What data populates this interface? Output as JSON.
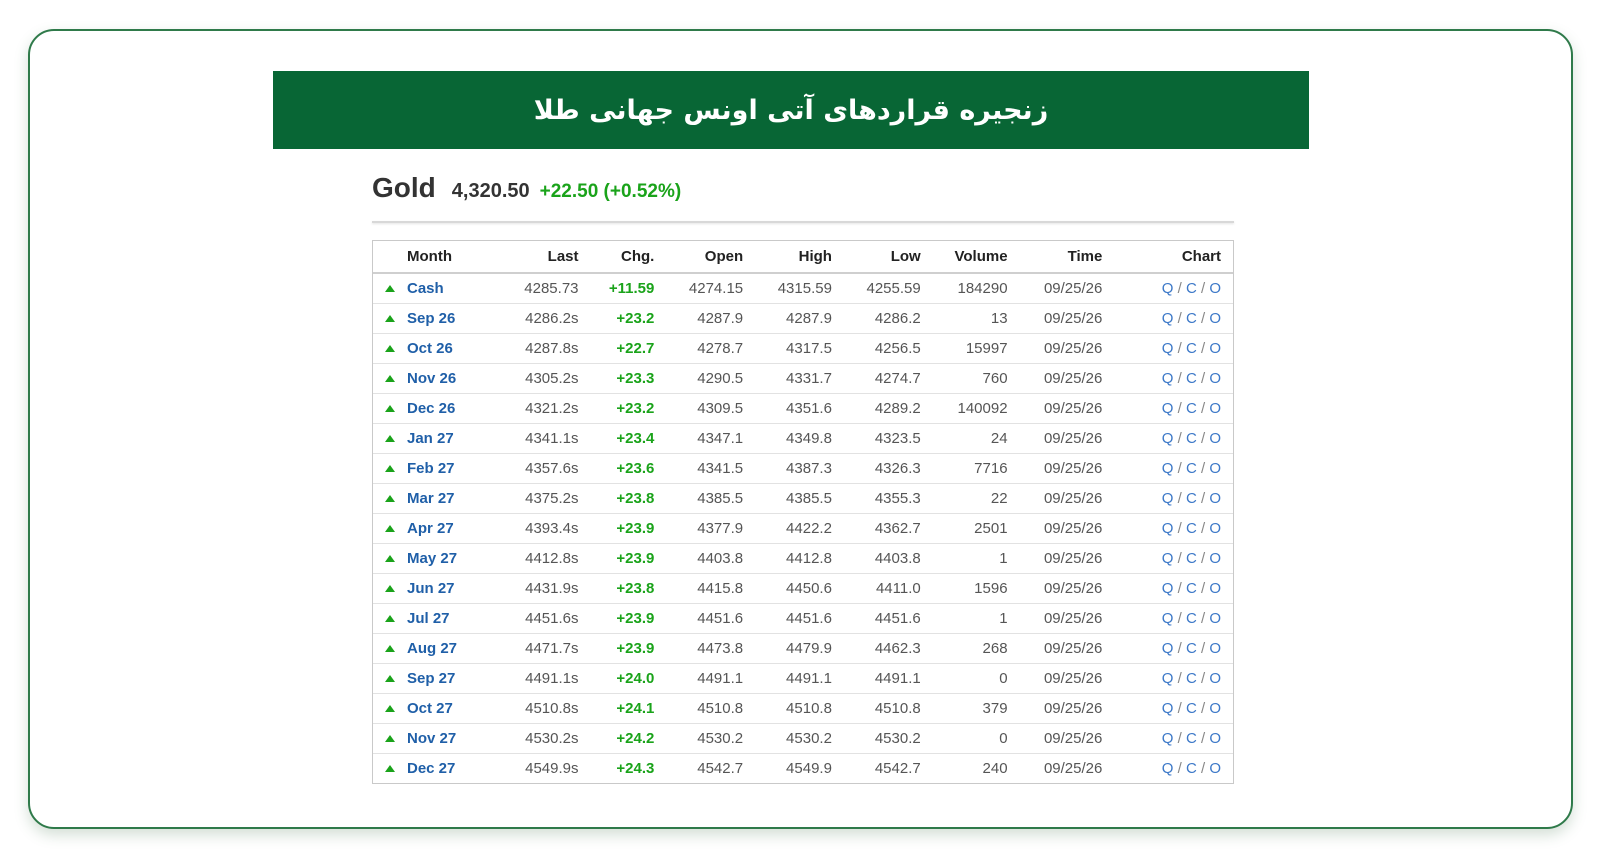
{
  "banner": {
    "title": "زنجیره قراردهای آتی اونس جهانی طلا"
  },
  "quote": {
    "name": "Gold",
    "price": "4,320.50",
    "change": "+22.50 (+0.52%)"
  },
  "table": {
    "columns": [
      "Month",
      "Last",
      "Chg.",
      "Open",
      "High",
      "Low",
      "Volume",
      "Time",
      "Chart"
    ],
    "chart_links": [
      "Q",
      "C",
      "O"
    ],
    "chart_sep": "/",
    "rows": [
      {
        "month": "Cash",
        "last": "4285.73",
        "chg": "+11.59",
        "open": "4274.15",
        "high": "4315.59",
        "low": "4255.59",
        "volume": "184290",
        "time": "09/25/26"
      },
      {
        "month": "Sep 26",
        "last": "4286.2s",
        "chg": "+23.2",
        "open": "4287.9",
        "high": "4287.9",
        "low": "4286.2",
        "volume": "13",
        "time": "09/25/26"
      },
      {
        "month": "Oct 26",
        "last": "4287.8s",
        "chg": "+22.7",
        "open": "4278.7",
        "high": "4317.5",
        "low": "4256.5",
        "volume": "15997",
        "time": "09/25/26"
      },
      {
        "month": "Nov 26",
        "last": "4305.2s",
        "chg": "+23.3",
        "open": "4290.5",
        "high": "4331.7",
        "low": "4274.7",
        "volume": "760",
        "time": "09/25/26"
      },
      {
        "month": "Dec 26",
        "last": "4321.2s",
        "chg": "+23.2",
        "open": "4309.5",
        "high": "4351.6",
        "low": "4289.2",
        "volume": "140092",
        "time": "09/25/26"
      },
      {
        "month": "Jan 27",
        "last": "4341.1s",
        "chg": "+23.4",
        "open": "4347.1",
        "high": "4349.8",
        "low": "4323.5",
        "volume": "24",
        "time": "09/25/26"
      },
      {
        "month": "Feb 27",
        "last": "4357.6s",
        "chg": "+23.6",
        "open": "4341.5",
        "high": "4387.3",
        "low": "4326.3",
        "volume": "7716",
        "time": "09/25/26"
      },
      {
        "month": "Mar 27",
        "last": "4375.2s",
        "chg": "+23.8",
        "open": "4385.5",
        "high": "4385.5",
        "low": "4355.3",
        "volume": "22",
        "time": "09/25/26"
      },
      {
        "month": "Apr 27",
        "last": "4393.4s",
        "chg": "+23.9",
        "open": "4377.9",
        "high": "4422.2",
        "low": "4362.7",
        "volume": "2501",
        "time": "09/25/26"
      },
      {
        "month": "May 27",
        "last": "4412.8s",
        "chg": "+23.9",
        "open": "4403.8",
        "high": "4412.8",
        "low": "4403.8",
        "volume": "1",
        "time": "09/25/26"
      },
      {
        "month": "Jun 27",
        "last": "4431.9s",
        "chg": "+23.8",
        "open": "4415.8",
        "high": "4450.6",
        "low": "4411.0",
        "volume": "1596",
        "time": "09/25/26"
      },
      {
        "month": "Jul 27",
        "last": "4451.6s",
        "chg": "+23.9",
        "open": "4451.6",
        "high": "4451.6",
        "low": "4451.6",
        "volume": "1",
        "time": "09/25/26"
      },
      {
        "month": "Aug 27",
        "last": "4471.7s",
        "chg": "+23.9",
        "open": "4473.8",
        "high": "4479.9",
        "low": "4462.3",
        "volume": "268",
        "time": "09/25/26"
      },
      {
        "month": "Sep 27",
        "last": "4491.1s",
        "chg": "+24.0",
        "open": "4491.1",
        "high": "4491.1",
        "low": "4491.1",
        "volume": "0",
        "time": "09/25/26"
      },
      {
        "month": "Oct 27",
        "last": "4510.8s",
        "chg": "+24.1",
        "open": "4510.8",
        "high": "4510.8",
        "low": "4510.8",
        "volume": "379",
        "time": "09/25/26"
      },
      {
        "month": "Nov 27",
        "last": "4530.2s",
        "chg": "+24.2",
        "open": "4530.2",
        "high": "4530.2",
        "low": "4530.2",
        "volume": "0",
        "time": "09/25/26"
      },
      {
        "month": "Dec 27",
        "last": "4549.9s",
        "chg": "+24.3",
        "open": "4542.7",
        "high": "4549.9",
        "low": "4542.7",
        "volume": "240",
        "time": "09/25/26"
      }
    ]
  },
  "colors": {
    "banner_bg": "#086635",
    "card_border": "#2f7a4a",
    "positive": "#1aa31a",
    "link": "#1f5fa8",
    "chart_link": "#3c78c8"
  },
  "icons": {
    "row_trend": "arrow-up-icon"
  }
}
